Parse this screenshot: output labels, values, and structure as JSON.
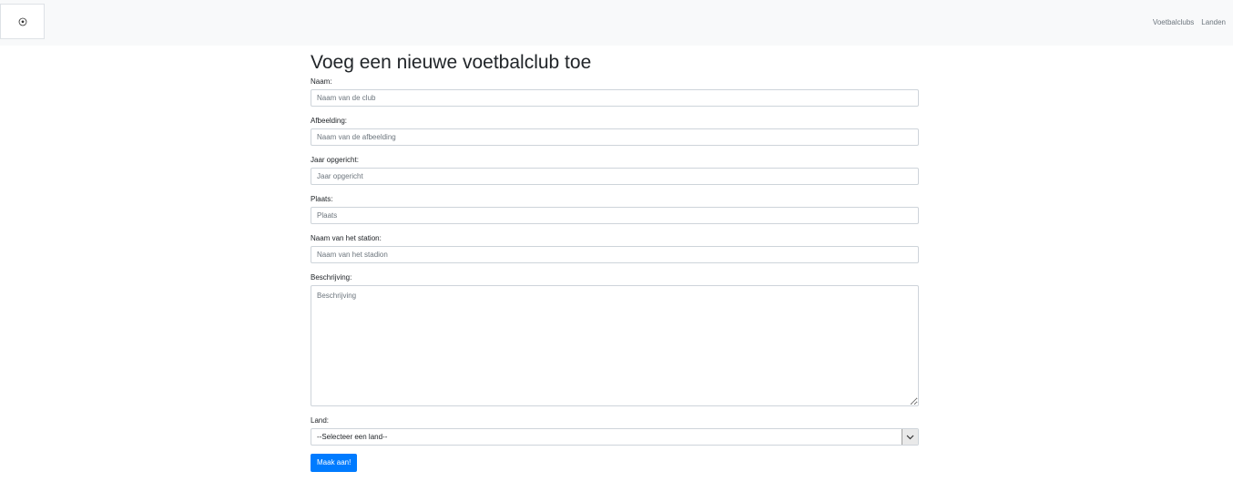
{
  "navbar": {
    "logo_icon": "soccer-ball-icon",
    "links": [
      "Voetbalclubs",
      "Landen"
    ]
  },
  "page": {
    "title": "Voeg een nieuwe voetbalclub toe"
  },
  "form": {
    "naam": {
      "label": "Naam:",
      "placeholder": "Naam van de club"
    },
    "afbeelding": {
      "label": "Afbeelding:",
      "placeholder": "Naam van de afbeelding"
    },
    "jaar": {
      "label": "Jaar opgericht:",
      "placeholder": "Jaar opgericht"
    },
    "plaats": {
      "label": "Plaats:",
      "placeholder": "Plaats"
    },
    "stadion": {
      "label": "Naam van het station:",
      "placeholder": "Naam van het stadion"
    },
    "beschrijving": {
      "label": "Beschrijving:",
      "placeholder": "Beschrijving"
    },
    "land": {
      "label": "Land:",
      "selected": "--Selecteer een land--"
    },
    "submit_label": "Maak aan!"
  },
  "colors": {
    "navbar_bg": "#f8f9fa",
    "primary": "#007bff",
    "border": "#ced4da"
  }
}
